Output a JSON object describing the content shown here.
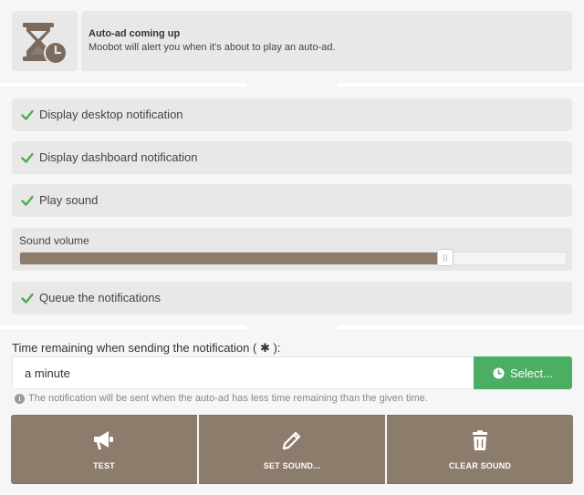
{
  "header": {
    "title": "Auto-ad coming up",
    "description": "Moobot will alert you when it's about to play an auto-ad.",
    "icon": "hourglass-clock-icon"
  },
  "options": [
    {
      "label": "Display desktop notification",
      "checked": true
    },
    {
      "label": "Display dashboard notification",
      "checked": true
    },
    {
      "label": "Play sound",
      "checked": true
    }
  ],
  "volume": {
    "label": "Sound volume",
    "value_fraction": 0.78
  },
  "queue": {
    "label": "Queue the notifications",
    "checked": true
  },
  "time": {
    "label": "Time remaining when sending the notification ( ✱ ):",
    "value": "a minute",
    "select_label": "Select...",
    "hint": "The notification will be sent when the auto-ad has less time remaining than the given time."
  },
  "actions": {
    "test": "TEST",
    "set_sound": "SET SOUND...",
    "clear_sound": "CLEAR SOUND"
  },
  "colors": {
    "accent_brown": "#8c7c6c",
    "select_green": "#4cae62",
    "check_green": "#4caf50"
  }
}
